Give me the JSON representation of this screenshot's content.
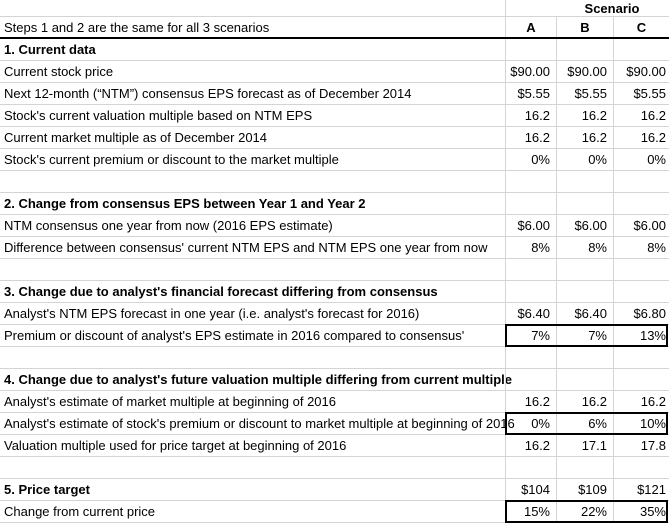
{
  "header": {
    "scenario_label": "Scenario",
    "note": "Steps 1 and 2 are the same for all 3 scenarios",
    "columns": [
      "A",
      "B",
      "C"
    ]
  },
  "sections": [
    {
      "title": "1. Current data",
      "rows": [
        {
          "label": "Current stock price",
          "values": [
            "$90.00",
            "$90.00",
            "$90.00"
          ],
          "boxed": false
        },
        {
          "label": "Next 12-month (“NTM”) consensus EPS forecast as of December 2014",
          "values": [
            "$5.55",
            "$5.55",
            "$5.55"
          ],
          "boxed": false
        },
        {
          "label": "Stock's current valuation multiple based on NTM EPS",
          "values": [
            "16.2",
            "16.2",
            "16.2"
          ],
          "boxed": false
        },
        {
          "label": "Current market multiple as of December 2014",
          "values": [
            "16.2",
            "16.2",
            "16.2"
          ],
          "boxed": false
        },
        {
          "label": "Stock's current premium or discount to the market multiple",
          "values": [
            "0%",
            "0%",
            "0%"
          ],
          "boxed": false
        }
      ]
    },
    {
      "title": "2. Change from consensus EPS between Year 1 and Year 2",
      "rows": [
        {
          "label": "NTM consensus one year from now (2016 EPS estimate)",
          "values": [
            "$6.00",
            "$6.00",
            "$6.00"
          ],
          "boxed": false
        },
        {
          "label": "Difference between consensus' current NTM EPS and NTM EPS one year from now",
          "values": [
            "8%",
            "8%",
            "8%"
          ],
          "boxed": false
        }
      ]
    },
    {
      "title": "3. Change due to analyst's financial forecast differing from consensus",
      "rows": [
        {
          "label": "Analyst's NTM EPS forecast in one year (i.e. analyst's forecast for 2016)",
          "values": [
            "$6.40",
            "$6.40",
            "$6.80"
          ],
          "boxed": false
        },
        {
          "label": "Premium or discount of analyst's EPS estimate in 2016 compared to consensus'",
          "values": [
            "7%",
            "7%",
            "13%"
          ],
          "boxed": true
        }
      ]
    },
    {
      "title": "4. Change due to analyst's future valuation multiple differing from current multiple",
      "rows": [
        {
          "label": "Analyst's estimate of market multiple at beginning of 2016",
          "values": [
            "16.2",
            "16.2",
            "16.2"
          ],
          "boxed": false
        },
        {
          "label": "Analyst's estimate of stock's premium or discount to market multiple at beginning of 2016",
          "values": [
            "0%",
            "6%",
            "10%"
          ],
          "boxed": true
        },
        {
          "label": "Valuation multiple used for price target at beginning of 2016",
          "values": [
            "16.2",
            "17.1",
            "17.8"
          ],
          "boxed": false
        }
      ]
    },
    {
      "title": "5. Price target",
      "title_values": [
        "$104",
        "$109",
        "$121"
      ],
      "rows": [
        {
          "label": "Change from current price",
          "values": [
            "15%",
            "22%",
            "35%"
          ],
          "boxed": true
        }
      ]
    }
  ]
}
